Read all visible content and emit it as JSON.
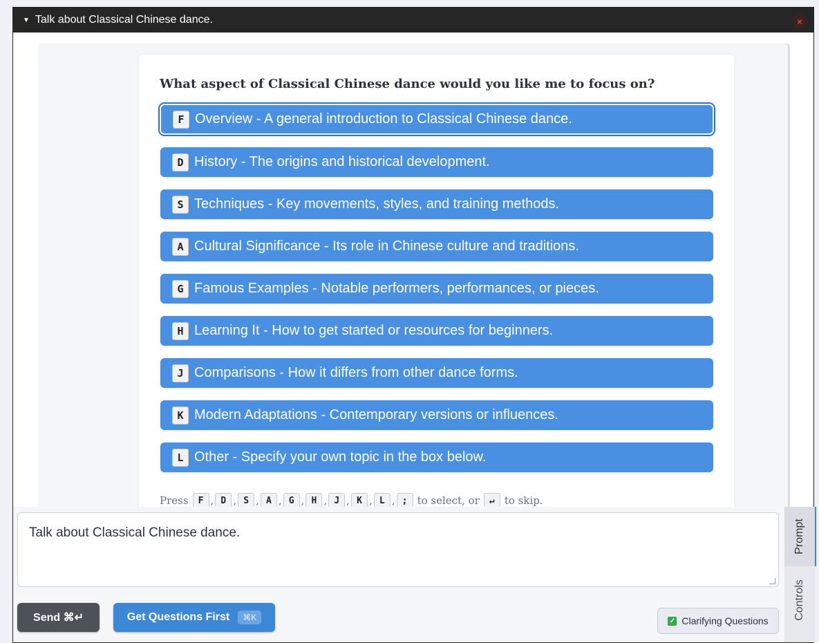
{
  "window": {
    "title": "Talk about Classical Chinese dance.",
    "close_symbol": "×"
  },
  "question": "What aspect of Classical Chinese dance would you like me to focus on?",
  "options": [
    {
      "key": "F",
      "label": "Overview - A general introduction to Classical Chinese dance."
    },
    {
      "key": "D",
      "label": "History - The origins and historical development."
    },
    {
      "key": "S",
      "label": "Techniques - Key movements, styles, and training methods."
    },
    {
      "key": "A",
      "label": "Cultural Significance - Its role in Chinese culture and traditions."
    },
    {
      "key": "G",
      "label": "Famous Examples - Notable performers, performances, or pieces."
    },
    {
      "key": "H",
      "label": "Learning It - How to get started or resources for beginners."
    },
    {
      "key": "J",
      "label": "Comparisons - How it differs from other dance forms."
    },
    {
      "key": "K",
      "label": "Modern Adaptations - Contemporary versions or influences."
    },
    {
      "key": "L",
      "label": "Other - Specify your own topic in the box below."
    }
  ],
  "hint": {
    "prefix": "Press",
    "keys": [
      "F",
      "D",
      "S",
      "A",
      "G",
      "H",
      "J",
      "K",
      "L",
      ";"
    ],
    "middle": "to select, or",
    "skip_key": "↵",
    "suffix": "to skip."
  },
  "prompt": {
    "value": "Talk about Classical Chinese dance."
  },
  "buttons": {
    "send_label": "Send ⌘↵",
    "get_questions_label": "Get Questions First",
    "get_questions_shortcut": "⌘K",
    "clarifying_label": "Clarifying Questions",
    "clarifying_checked_symbol": "✓"
  },
  "side_tabs": {
    "prompt": "Prompt",
    "controls": "Controls"
  },
  "colors": {
    "option_bg": "#4a90e2",
    "titlebar_bg": "#262626",
    "send_bg": "#4d5259",
    "primary_bg": "#3d88d6"
  }
}
